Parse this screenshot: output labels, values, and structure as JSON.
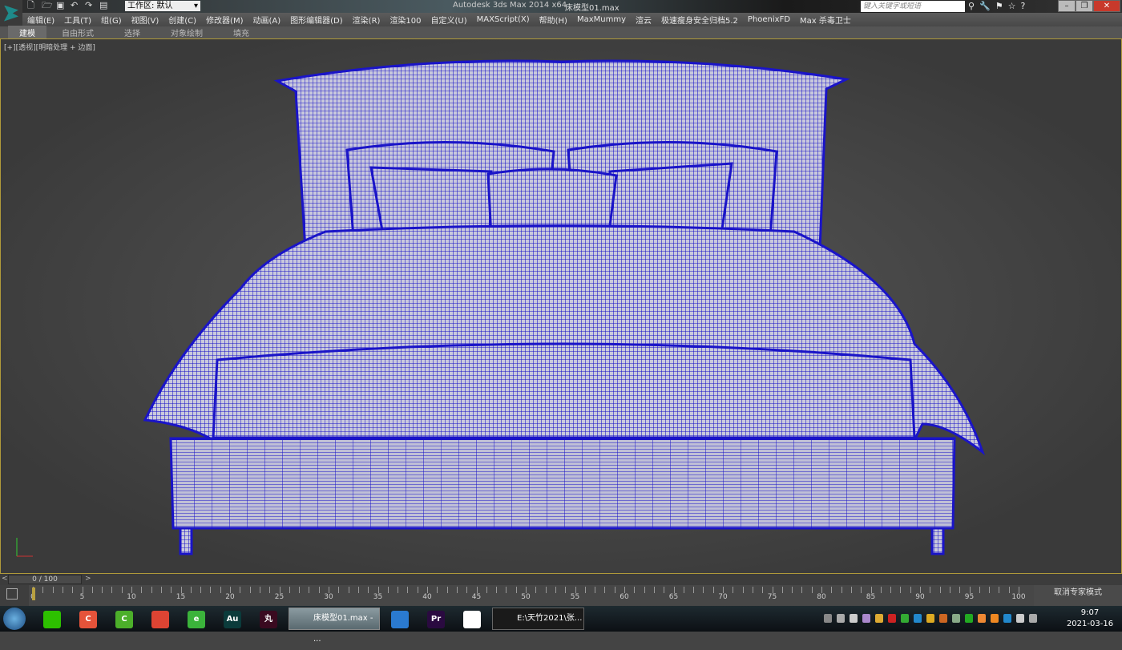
{
  "titlebar": {
    "app_title": "Autodesk 3ds Max  2014 x64",
    "file_title": "床模型01.max",
    "workspace": "工作区: 默认",
    "search_placeholder": "键入关键字或短语",
    "min": "–",
    "restore": "❐",
    "close": "✕"
  },
  "quick_access": [
    "new-icon",
    "open-icon",
    "save-icon",
    "undo-icon",
    "redo-icon",
    "project-icon"
  ],
  "menu": [
    "编辑(E)",
    "工具(T)",
    "组(G)",
    "视图(V)",
    "创建(C)",
    "修改器(M)",
    "动画(A)",
    "图形编辑器(D)",
    "渲染(R)",
    "渲染100",
    "自定义(U)",
    "MAXScript(X)",
    "帮助(H)",
    "MaxMummy",
    "渲云",
    "极速瘦身安全归档5.2",
    "PhoenixFD",
    "Max 杀毒卫士"
  ],
  "ribbon_tabs": [
    "建模",
    "自由形式",
    "选择",
    "对象绘制",
    "填充"
  ],
  "viewport": {
    "label": "[+][透视][明暗处理 + 边面]"
  },
  "timeslider": {
    "value": "0 / 100",
    "prev": "<",
    "next": ">"
  },
  "trackbar": {
    "ticks": [
      "0",
      "5",
      "10",
      "15",
      "20",
      "25",
      "30",
      "35",
      "40",
      "45",
      "50",
      "55",
      "60",
      "65",
      "70",
      "75",
      "80",
      "85",
      "90",
      "95",
      "100"
    ],
    "expert_mode": "取消专家模式"
  },
  "taskbar": {
    "apps": [
      {
        "label": "",
        "color": "#2dc100"
      },
      {
        "label": "C",
        "color": "#e5533a"
      },
      {
        "label": "C",
        "color": "#4caf2a"
      },
      {
        "label": "",
        "color": "#dd4433"
      },
      {
        "label": "e",
        "color": "#3bb33b"
      },
      {
        "label": "Au",
        "color": "#0b3b3b"
      },
      {
        "label": "丸",
        "color": "#3a0a20"
      }
    ],
    "max_window": "床模型01.max - ...",
    "apps2": [
      {
        "label": "",
        "color": "#2a7ad0"
      },
      {
        "label": "Pr",
        "color": "#2a0a40"
      },
      {
        "label": "",
        "color": "#ffffff"
      }
    ],
    "explorer_window": "E:\\天竹2021\\张...",
    "time": "9:07",
    "date": "2021-03-16"
  },
  "colors": {
    "wire": "#1a14c8",
    "viewport_border": "#b09a3a"
  }
}
